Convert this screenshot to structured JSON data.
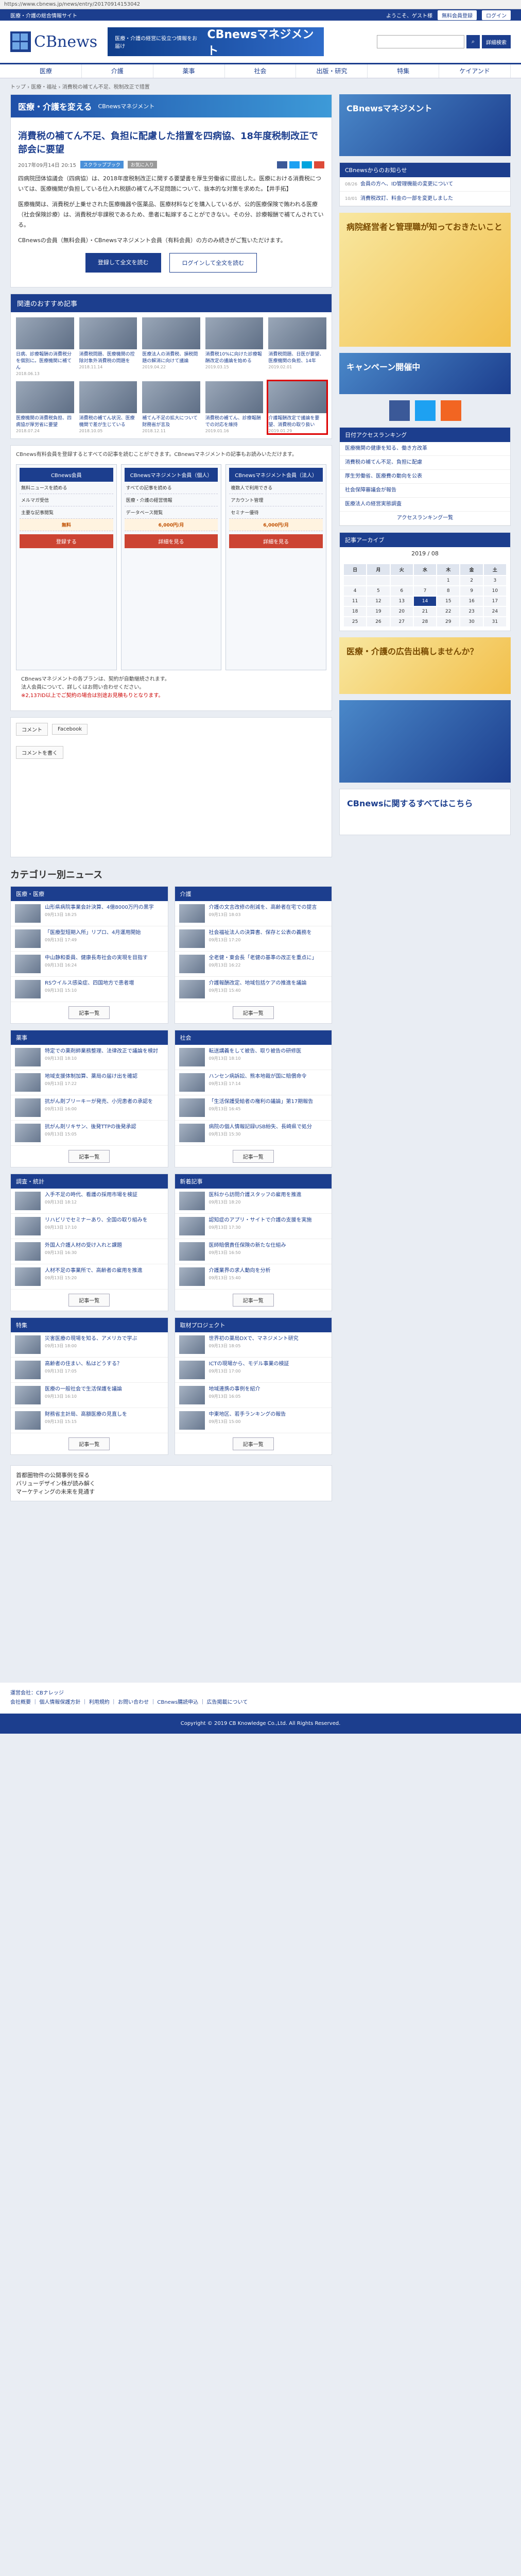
{
  "browser": {
    "url": "https://www.cbnews.jp/news/entry/20170914153042"
  },
  "topbar": {
    "tagline": "医療・介護の総合情報サイト",
    "welcome": "ようこそ、ゲスト様",
    "member_register": "無料会員登録",
    "login": "ログイン"
  },
  "header": {
    "logo": "CBnews",
    "banner_small": "医療・介護の経営に役立つ情報をお届け",
    "banner_large": "CBnewsマネジメント",
    "search_placeholder": "",
    "detail_search": "詳細検索"
  },
  "nav": [
    "医療",
    "介護",
    "薬事",
    "社会",
    "出版・研究",
    "特集",
    "ケイアンド"
  ],
  "breadcrumb": "トップ › 医療・福祉 › 消費税の補てん不足、税制改正で措置",
  "ad_strip": {
    "text": "医療・介護を変える",
    "sub": "CBnewsマネジメント"
  },
  "article": {
    "title": "消費税の補てん不足、負担に配慮した措置を四病協、18年度税制改正で部会に要望",
    "date": "2017年09月14日 20:15",
    "tag1": "スクラップブック",
    "tag2": "お気に入り",
    "para1": "四病院団体協議会（四病協）は、2018年度税制改正に関する要望書を厚生労働省に提出した。医療における消費税については、医療機関が負担している仕入れ税額の補てん不足問題について、抜本的な対策を求めた。【井手拓】",
    "para2": "医療機関は、消費税が上乗せされた医療機器や医薬品、医療材料などを購入しているが、公的医療保険で賄われる医療（社会保険診療）は、消費税が非課税であるため、患者に転嫁することができない。その分、診療報酬で補てんされている。",
    "para3": "CBnewsの会員（無料会員）・CBnewsマネジメント会員（有料会員）の方のみ続きがご覧いただけます。",
    "register_btn": "登録して全文を読む",
    "login_btn": "ログインして全文を読む"
  },
  "related": {
    "title": "関連のおすすめ記事",
    "items": [
      {
        "cap": "日病、診療報酬の消費税分を個別に。医療機関に補てん",
        "date": "2018.06.13"
      },
      {
        "cap": "消費税問題、医療機関の控除対象外消費税の問題を",
        "date": "2018.11.14"
      },
      {
        "cap": "医療法人の消費税、損税問題の解消に向けて議論",
        "date": "2019.04.22"
      },
      {
        "cap": "消費税10%に向けた診療報酬改定の議論を始める",
        "date": "2019.03.15"
      },
      {
        "cap": "消費税問題、日医が要望、医療機関の負担、14年",
        "date": "2019.02.01"
      },
      {
        "cap": "医療機関の消費税負担、四病協が厚労省に要望",
        "date": "2018.07.24"
      },
      {
        "cap": "消費税の補てん状況、医療機関で差が生じている",
        "date": "2018.10.05"
      },
      {
        "cap": "補てん不足の拡大について財務省が言及",
        "date": "2018.12.11"
      },
      {
        "cap": "消費税の補てん、診療報酬での対応を維持",
        "date": "2019.01.16"
      },
      {
        "cap": "介護報酬改定で議論を要望、消費税の取り扱い",
        "date": "2019.01.29"
      }
    ]
  },
  "plans": {
    "intro": "CBnews有料会員を登録するとすべての記事を読むことができます。CBnewsマネジメントの記事もお読みいただけます。",
    "cols": [
      {
        "head": "CBnews会員",
        "rows": [
          "無料ニュースを読める",
          "メルマガ受信",
          "主要な記事閲覧"
        ],
        "price": "無料",
        "btn": "登録する"
      },
      {
        "head": "CBnewsマネジメント会員（個人）",
        "rows": [
          "すべての記事を読める",
          "医療・介護の経営情報",
          "データベース閲覧"
        ],
        "price": "6,000円/月",
        "btn": "詳細を見る"
      },
      {
        "head": "CBnewsマネジメント会員（法人）",
        "rows": [
          "複数人で利用できる",
          "アカウント管理",
          "セミナー優待"
        ],
        "price": "6,000円/月",
        "btn": "詳細を見る"
      }
    ],
    "note1": "CBnewsマネジメントの各プランは、契約が自動継続されます。",
    "note2": "法人会員について、詳しくはお問い合わせください。",
    "note3": "※2,137ID以上でご契約の場合は別途お見積もりとなります。"
  },
  "comments": {
    "label": "コメント",
    "fb": "Facebook",
    "post": "コメントを書く"
  },
  "categories": {
    "heading": "カテゴリー別ニュース",
    "boxes": [
      {
        "title": "医療・医療",
        "items": [
          {
            "t": "山形県病院事業会計決算、4億8000万円の黒字",
            "d": "09月13日 18:25"
          },
          {
            "t": "「医療型短期入所」リプロ、4月運用開始",
            "d": "09月13日 17:49"
          },
          {
            "t": "中山静和委員、健康長寿社会の実現を目指す",
            "d": "09月13日 16:24"
          },
          {
            "t": "RSウイルス感染症、四国地方で患者増",
            "d": "09月13日 15:10"
          }
        ],
        "more": "記事一覧"
      },
      {
        "title": "介護",
        "items": [
          {
            "t": "介護の文言改修の削減を、高齢者在宅での提言",
            "d": "09月13日 18:03"
          },
          {
            "t": "社会福祉法人の決算書、保存と公表の義務を",
            "d": "09月13日 17:20"
          },
          {
            "t": "全老健・東会長「老健の基準の改正を重点に」",
            "d": "09月13日 16:22"
          },
          {
            "t": "介護報酬改定、地域包括ケアの推進を議論",
            "d": "09月13日 15:40"
          }
        ],
        "more": "記事一覧"
      },
      {
        "title": "薬事",
        "items": [
          {
            "t": "特定での薬剤師業務整理、法律改正で議論を検討",
            "d": "09月13日 18:10"
          },
          {
            "t": "地域支援体制加算、薬局の届け出を確認",
            "d": "09月13日 17:22"
          },
          {
            "t": "抗がん剤ブリーキーが発売、小児患者の承認を",
            "d": "09月13日 16:00"
          },
          {
            "t": "抗がん剤リキサン、後発TTPの後発承認",
            "d": "09月13日 15:05"
          }
        ],
        "more": "記事一覧"
      },
      {
        "title": "社会",
        "items": [
          {
            "t": "転送講義をして被告、取り被告の研修医",
            "d": "09月13日 18:10"
          },
          {
            "t": "ハンセン病訴訟、熊本地裁が国に賠償命令",
            "d": "09月13日 17:14"
          },
          {
            "t": "「生活保護受給者の権利の議論」第17期報告",
            "d": "09月13日 16:45"
          },
          {
            "t": "病院の個人情報記録USB紛失、長崎県で処分",
            "d": "09月13日 15:30"
          }
        ],
        "more": "記事一覧"
      },
      {
        "title": "調査・統計",
        "items": [
          {
            "t": "入手不足の時代、看護の採用市場を検証",
            "d": "09月13日 18:12"
          },
          {
            "t": "リハビリでセミナーあり、全国の取り組みを",
            "d": "09月13日 17:10"
          },
          {
            "t": "外国人介護人材の受け入れと課題",
            "d": "09月13日 16:30"
          },
          {
            "t": "人材不足の事業所で、高齢者の雇用を推進",
            "d": "09月13日 15:20"
          }
        ],
        "more": "記事一覧"
      },
      {
        "title": "新着記事",
        "items": [
          {
            "t": "医科から訪問介護スタッフの雇用を推進",
            "d": "09月13日 18:20"
          },
          {
            "t": "認知症のアプリ・サイトで介護の支援を実施",
            "d": "09月13日 17:30"
          },
          {
            "t": "医師賠償責任保険の新たな仕組み",
            "d": "09月13日 16:50"
          },
          {
            "t": "介護業界の求人動向を分析",
            "d": "09月13日 15:40"
          }
        ],
        "more": "記事一覧"
      },
      {
        "title": "特集",
        "items": [
          {
            "t": "災害医療の現場を知る、アメリカで学ぶ",
            "d": "09月13日 18:00"
          },
          {
            "t": "高齢者の住まい、私はどうする？",
            "d": "09月13日 17:05"
          },
          {
            "t": "医療の一般社会で生活保護を議論",
            "d": "09月13日 16:10"
          },
          {
            "t": "財務省主計局、高額医療の見直しを",
            "d": "09月13日 15:15"
          }
        ],
        "more": "記事一覧"
      },
      {
        "title": "取材プロジェクト",
        "items": [
          {
            "t": "世界初の薬局DXで、マネジメント研究",
            "d": "09月13日 18:05"
          },
          {
            "t": "ICTの現場から、モデル事業の検証",
            "d": "09月13日 17:00"
          },
          {
            "t": "地域連携の事例を紹介",
            "d": "09月13日 16:05"
          },
          {
            "t": "中東地区、若手ランキングの報告",
            "d": "09月13日 15:00"
          }
        ],
        "more": "記事一覧"
      }
    ]
  },
  "ads_bottom": [
    {
      "t": "首都圏物件の公開事例を探る"
    },
    {
      "t": "バリューデザイン株が読み解く"
    },
    {
      "t": "マーケティングの未来を見通す"
    }
  ],
  "sidebar": {
    "banner": "CBnewsマネジメント",
    "news_title": "CBnewsからのお知らせ",
    "news": [
      {
        "d": "08/26",
        "t": "会員の方へ、ID管理機能の変更について"
      },
      {
        "d": "10/01",
        "t": "消費税改訂、料金の一部を変更しました"
      }
    ],
    "ad1": "病院経営者と管理職が知っておきたいこと",
    "ad2": "キャンペーン開催中",
    "ranking_title": "日付アクセスランキング",
    "ranking": [
      "医療機関の健康を知る、働き方改革",
      "消費税の補てん不足、負担に配慮",
      "厚生労働省、医療費の動向を公表",
      "社会保障審議会が報告",
      "医療法人の経営実態調査"
    ],
    "ranking_more": "アクセスランキング一覧",
    "archive_title": "記事アーカイブ",
    "cal_month": "2019 / 08",
    "cal_head": [
      "日",
      "月",
      "火",
      "水",
      "木",
      "金",
      "土"
    ],
    "ad3": "医療・介護の広告出稿しませんか？",
    "ad4": "CBnewsに関するすべてはこちら"
  },
  "footer": {
    "links": "会社概要 ｜ 個人情報保護方針 ｜ 利用規約 ｜ お問い合わせ ｜ CBnews購読申込 ｜ 広告掲載について",
    "copy": "Copyright © 2019 CB Knowledge Co.,Ltd. All Rights Reserved.",
    "company": "運営会社：CBナレッジ"
  },
  "colors": {
    "brand": "#1c3e8e",
    "accent": "#c43"
  }
}
